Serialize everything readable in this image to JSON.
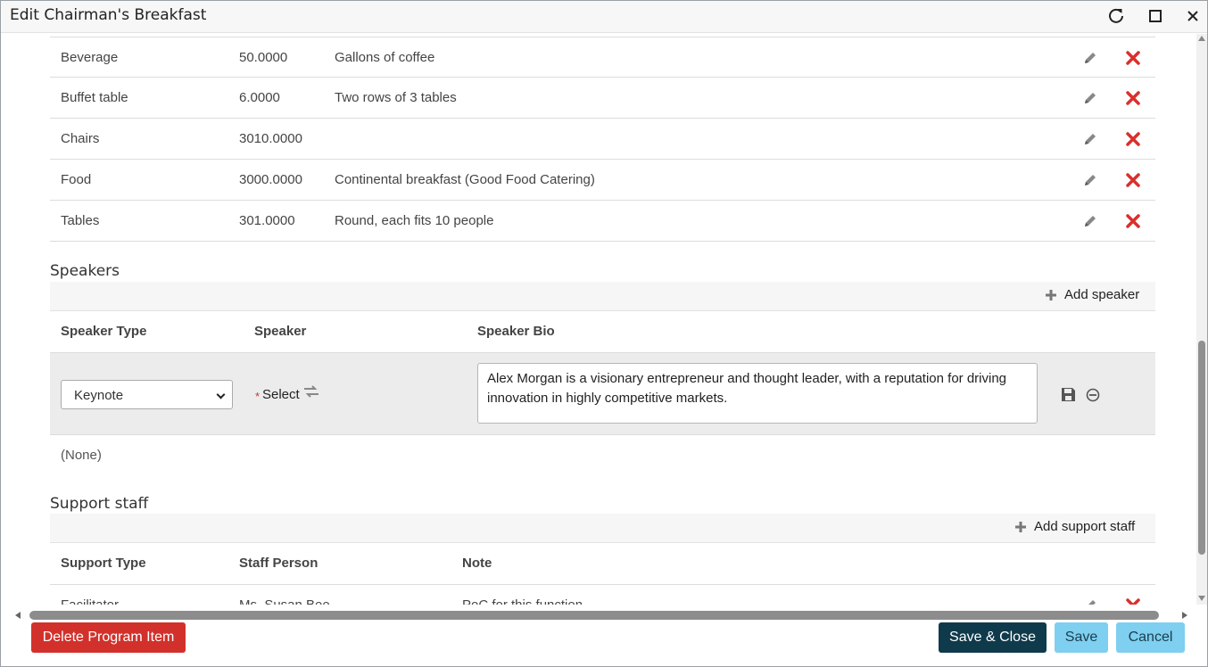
{
  "window": {
    "title": "Edit Chairman's Breakfast"
  },
  "resources": {
    "rows": [
      {
        "name": "Beverage",
        "quantity": "50.0000",
        "note": "Gallons of coffee"
      },
      {
        "name": "Buffet table",
        "quantity": "6.0000",
        "note": "Two rows of 3 tables"
      },
      {
        "name": "Chairs",
        "quantity": "3010.0000",
        "note": ""
      },
      {
        "name": "Food",
        "quantity": "3000.0000",
        "note": "Continental breakfast (Good Food Catering)"
      },
      {
        "name": "Tables",
        "quantity": "301.0000",
        "note": "Round, each fits 10 people"
      }
    ]
  },
  "speakers": {
    "title": "Speakers",
    "add_label": "Add speaker",
    "columns": [
      "Speaker Type",
      "Speaker",
      "Speaker Bio"
    ],
    "edit_row": {
      "type_value": "Keynote",
      "required_mark": "*",
      "speaker_select_label": "Select",
      "bio": "Alex Morgan is a visionary entrepreneur and thought leader, with a reputation for driving innovation in highly competitive markets."
    },
    "empty_text": "(None)"
  },
  "support_staff": {
    "title": "Support staff",
    "add_label": "Add support staff",
    "columns": [
      "Support Type",
      "Staff Person",
      "Note"
    ],
    "rows": [
      {
        "type": "Facilitator",
        "person": "Ms. Susan Bee",
        "note": "PoC for this function"
      }
    ]
  },
  "footer": {
    "delete_label": "Delete Program Item",
    "save_close_label": "Save & Close",
    "save_label": "Save",
    "cancel_label": "Cancel"
  },
  "colors": {
    "delete_red": "#d2312b",
    "primary_dark": "#0f3a4b",
    "secondary_blue": "#7ecff0",
    "remove_x": "#d9302c"
  },
  "icons": [
    "refresh-icon",
    "maximize-icon",
    "close-icon",
    "pencil-icon",
    "delete-x-icon",
    "plus-icon",
    "swap-icon",
    "save-disk-icon",
    "cancel-circle-icon"
  ]
}
